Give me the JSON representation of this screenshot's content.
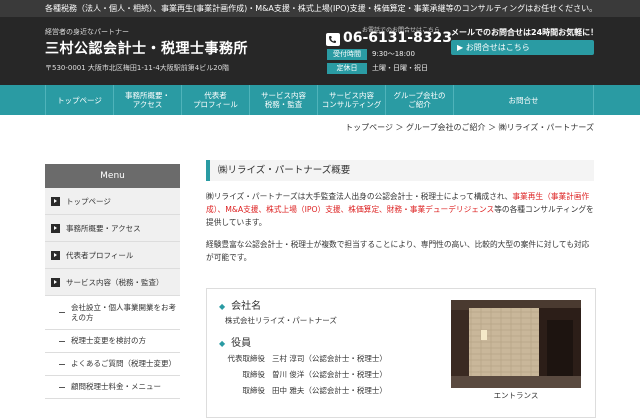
{
  "topbar": {
    "text": "各種税務（法人・個人・相続）、事業再生(事業計画作成)・M&A支援・株式上場(IPO)支援・株価算定・事業承継等のコンサルティングはお任せください。"
  },
  "header": {
    "tagline": "経営者の身近なパートナー",
    "firm_name": "三村公認会計士・税理士事務所",
    "address": "〒530-0001 大阪市北区梅田1-11-4大阪駅前第4ビル20階",
    "phone_note": "お電話でのお問合せはこちら",
    "phone": "06-6131-8323",
    "hours_label": "受付時間",
    "hours_value": "9:30～18:00",
    "closed_label": "定休日",
    "closed_value": "土曜・日曜・祝日",
    "mail_heading": "メールでのお問合せは24時間お気軽に！",
    "mail_button": "お問合せはこちら"
  },
  "nav": [
    {
      "label": "トップページ"
    },
    {
      "label": "事務所概要・\nアクセス"
    },
    {
      "label": "代表者\nプロフィール"
    },
    {
      "label": "サービス内容\n税務・監査"
    },
    {
      "label": "サービス内容\nコンサルティング"
    },
    {
      "label": "グループ会社の\nご紹介"
    },
    {
      "label": "お問合せ"
    }
  ],
  "breadcrumb": {
    "text": "トップページ ＞ グループ会社のご紹介 ＞ ㈱リライズ・パートナーズ"
  },
  "sidebar": {
    "heading": "Menu",
    "items": [
      {
        "label": "トップページ"
      },
      {
        "label": "事務所概要・アクセス"
      },
      {
        "label": "代表者プロフィール"
      },
      {
        "label": "サービス内容（税務・監査）"
      }
    ],
    "subitems": [
      {
        "label": "会社設立・個人事業開業をお考えの方"
      },
      {
        "label": "税理士変更を検討の方"
      },
      {
        "label": "よくあるご質問（税理士変更）"
      },
      {
        "label": "顧問税理士料金・メニュー"
      }
    ]
  },
  "main": {
    "title": "㈱リライズ・パートナーズ概要",
    "p1_a": "㈱リライズ・パートナーズは大手監査法人出身の公認会計士・税理士によって構成され、",
    "p1_red": "事業再生（事業計画作成）、M&A支援、株式上場（IPO）支援、株価算定、財務・事業デューデリジェンス",
    "p1_b": "等の各種コンサルティングを提供しています。",
    "p2": "経験豊富な公認会計士・税理士が複数で担当することにより、専門性の高い、比較的大型の案件に対しても対応が可能です。",
    "company_heading": "会社名",
    "company_name": "株式会社リライズ・パートナーズ",
    "officers_heading": "役員",
    "officers": [
      {
        "role": "代表取締役",
        "name": "三村 淳司（公認会計士・税理士）"
      },
      {
        "role": "取締役",
        "name": "曽川 俊洋（公認会計士・税理士）"
      },
      {
        "role": "取締役",
        "name": "田中 雅夫（公認会計士・税理士）"
      }
    ],
    "photo_caption": "エントランス"
  },
  "colors": {
    "accent": "#2a9ba3",
    "header": "#272727",
    "highlight": "#dd2222"
  }
}
